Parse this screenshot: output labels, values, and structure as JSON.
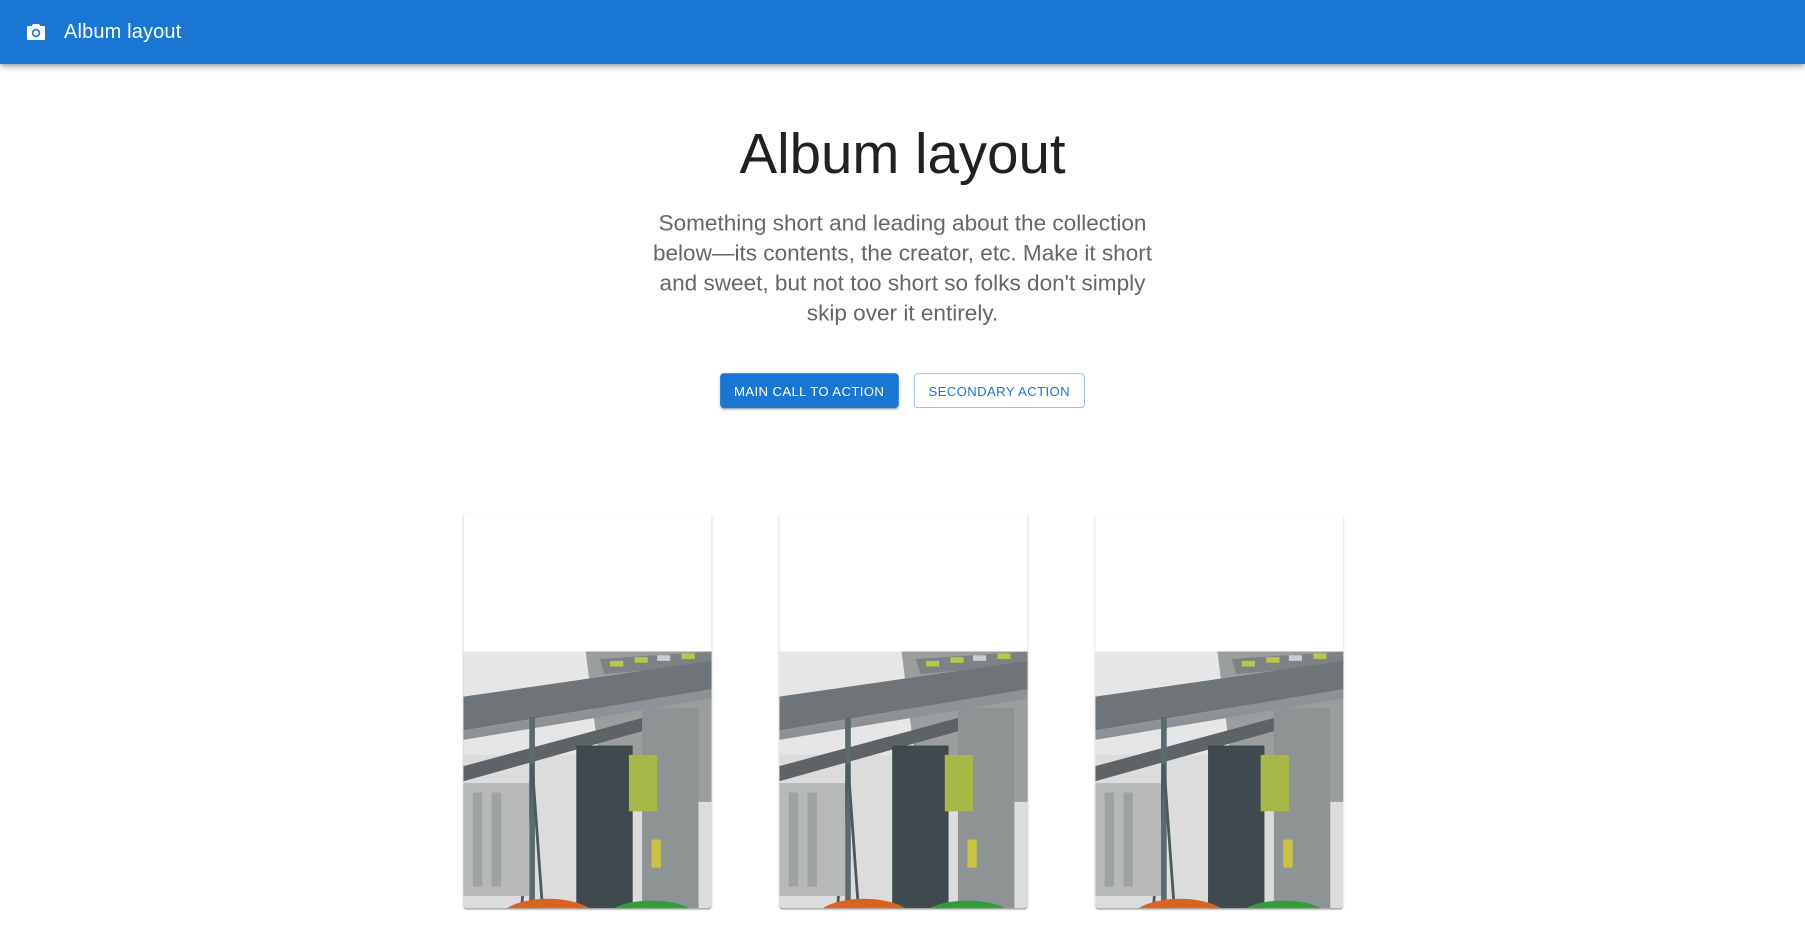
{
  "appbar": {
    "icon": "camera-icon",
    "title": "Album layout",
    "color": "#1976d2"
  },
  "hero": {
    "title": "Album layout",
    "subtitle": "Something short and leading about the collection below—its contents, the creator, etc. Make it short and sweet, but not too short so folks don't simply skip over it entirely.",
    "primary_action": "Main call to action",
    "secondary_action": "Secondary action"
  },
  "cards": [
    {
      "media": "photo of industrial building with orange and green cars"
    },
    {
      "media": "photo of industrial building with orange and green cars"
    },
    {
      "media": "photo of industrial building with orange and green cars"
    }
  ]
}
